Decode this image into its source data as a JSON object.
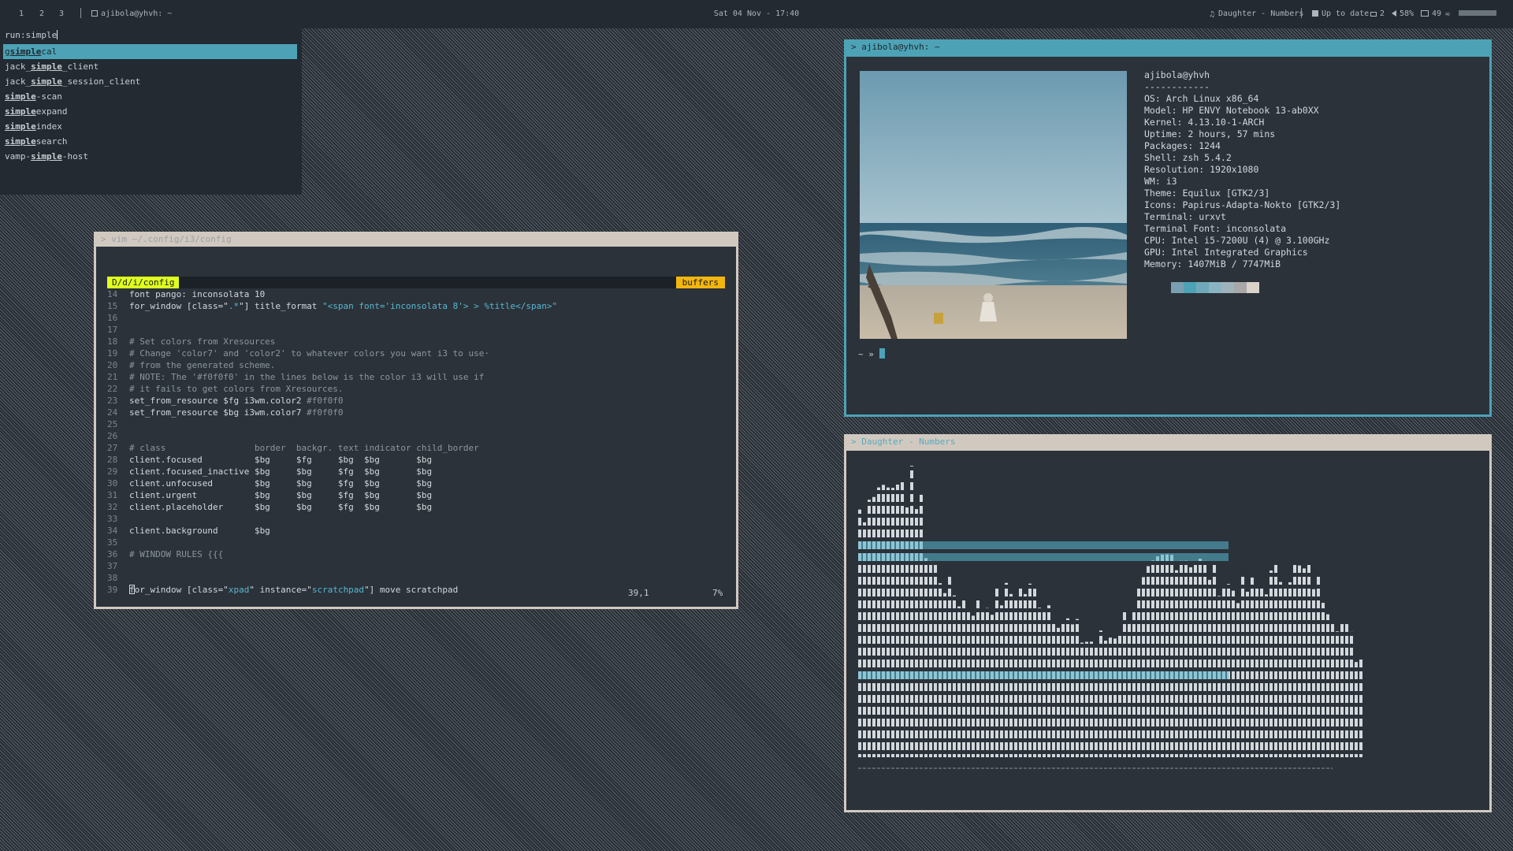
{
  "topbar": {
    "workspaces": [
      "1",
      "2",
      "3"
    ],
    "window_title": "ajibola@yhvh: ~",
    "clock": "Sat 04 Nov - 17:40",
    "music": "Daughter - Numbers",
    "updates": "Up to date",
    "mail_count": "2",
    "volume": "58%",
    "battery": "49"
  },
  "rofi": {
    "prompt": "run:simple",
    "items": [
      {
        "pre": "g",
        "match": "simple",
        "post": "cal",
        "selected": true
      },
      {
        "pre": "jack_",
        "match": "simple",
        "post": "_client",
        "selected": false
      },
      {
        "pre": "jack_",
        "match": "simple",
        "post": "_session_client",
        "selected": false
      },
      {
        "pre": "",
        "match": "simple",
        "post": "-scan",
        "selected": false
      },
      {
        "pre": "",
        "match": "simple",
        "post": "expand",
        "selected": false
      },
      {
        "pre": "",
        "match": "simple",
        "post": "index",
        "selected": false
      },
      {
        "pre": "",
        "match": "simple",
        "post": "search",
        "selected": false
      },
      {
        "pre": "vamp-",
        "match": "simple",
        "post": "-host",
        "selected": false
      }
    ]
  },
  "vim": {
    "title": "> vim ~/.config/i3/config",
    "file_tab": "D/d/i/config",
    "buffers_tab": "buffers",
    "ruler": "39,1",
    "percent": "7%",
    "lines": [
      {
        "n": "14",
        "segs": [
          [
            "t",
            "font pango: inconsolata 10"
          ]
        ]
      },
      {
        "n": "15",
        "segs": [
          [
            "t",
            "for_window [class=\""
          ],
          [
            "s",
            ".*"
          ],
          [
            "t",
            "\"] title_format "
          ],
          [
            "s",
            "\"<span font='inconsolata 8'> > %title</span>\""
          ]
        ]
      },
      {
        "n": "16",
        "segs": []
      },
      {
        "n": "17",
        "segs": []
      },
      {
        "n": "18",
        "segs": [
          [
            "c",
            "# Set colors from Xresources"
          ]
        ]
      },
      {
        "n": "19",
        "segs": [
          [
            "c",
            "# Change 'color7' and 'color2' to whatever colors you want i3 to use·"
          ]
        ]
      },
      {
        "n": "20",
        "segs": [
          [
            "c",
            "# from the generated scheme."
          ]
        ]
      },
      {
        "n": "21",
        "segs": [
          [
            "c",
            "# NOTE: The '#f0f0f0' in the lines below is the color i3 will use if"
          ]
        ]
      },
      {
        "n": "22",
        "segs": [
          [
            "c",
            "# it fails to get colors from Xresources."
          ]
        ]
      },
      {
        "n": "23",
        "segs": [
          [
            "t",
            "set_from_resource $fg i3wm.color2 "
          ],
          [
            "c",
            "#f0f0f0"
          ]
        ]
      },
      {
        "n": "24",
        "segs": [
          [
            "t",
            "set_from_resource $bg i3wm.color7 "
          ],
          [
            "c",
            "#f0f0f0"
          ]
        ]
      },
      {
        "n": "25",
        "segs": []
      },
      {
        "n": "26",
        "segs": []
      },
      {
        "n": "27",
        "segs": [
          [
            "c",
            "# class                 border  backgr. text indicator child_border"
          ]
        ]
      },
      {
        "n": "28",
        "segs": [
          [
            "t",
            "client.focused          $bg     $fg     $bg  $bg       $bg"
          ]
        ]
      },
      {
        "n": "29",
        "segs": [
          [
            "t",
            "client.focused_inactive $bg     $bg     $fg  $bg       $bg"
          ]
        ]
      },
      {
        "n": "30",
        "segs": [
          [
            "t",
            "client.unfocused        $bg     $bg     $fg  $bg       $bg"
          ]
        ]
      },
      {
        "n": "31",
        "segs": [
          [
            "t",
            "client.urgent           $bg     $bg     $fg  $bg       $bg"
          ]
        ]
      },
      {
        "n": "32",
        "segs": [
          [
            "t",
            "client.placeholder      $bg     $bg     $fg  $bg       $bg"
          ]
        ]
      },
      {
        "n": "33",
        "segs": []
      },
      {
        "n": "34",
        "segs": [
          [
            "t",
            "client.background       $bg"
          ]
        ]
      },
      {
        "n": "35",
        "segs": []
      },
      {
        "n": "36",
        "segs": [
          [
            "c",
            "# WINDOW RULES {{{"
          ]
        ]
      },
      {
        "n": "37",
        "segs": []
      },
      {
        "n": "38",
        "segs": []
      },
      {
        "n": "39",
        "segs": [
          [
            "k",
            "f"
          ],
          [
            "t",
            "or_window [class=\""
          ],
          [
            "s",
            "xpad"
          ],
          [
            "t",
            "\" instance=\""
          ],
          [
            "s",
            "scratchpad"
          ],
          [
            "t",
            "\"] move scratchpad"
          ]
        ]
      }
    ]
  },
  "terminal": {
    "title": "> ajibola@yhvh: ~",
    "user_host": "ajibola@yhvh",
    "underline": "------------",
    "info": [
      [
        "OS: ",
        "Arch Linux x86_64"
      ],
      [
        "Model: ",
        "HP ENVY Notebook 13-ab0XX"
      ],
      [
        "Kernel: ",
        "4.13.10-1-ARCH"
      ],
      [
        "Uptime: ",
        "2 hours, 57 mins"
      ],
      [
        "Packages: ",
        "1244"
      ],
      [
        "Shell: ",
        "zsh 5.4.2"
      ],
      [
        "Resolution: ",
        "1920x1080"
      ],
      [
        "WM: ",
        "i3"
      ],
      [
        "Theme: ",
        "Equilux [GTK2/3]"
      ],
      [
        "Icons: ",
        "Papirus-Adapta-Nokto [GTK2/3]"
      ],
      [
        "Terminal: ",
        "urxvt"
      ],
      [
        "Terminal Font: ",
        "inconsolata"
      ],
      [
        "CPU: ",
        "Intel i5-7200U (4) @ 3.100GHz"
      ],
      [
        "GPU: ",
        "Intel Integrated Graphics"
      ],
      [
        "Memory: ",
        "1407MiB / 7747MiB"
      ]
    ],
    "swatches": [
      "#2b323a",
      "#7a9fb2",
      "#4da2b6",
      "#6fa9b9",
      "#8ab4c2",
      "#9fb3bd",
      "#a8a8a8",
      "#dad3ca"
    ],
    "prompt": "~ »"
  },
  "cava": {
    "title": "> Daughter - Numbers",
    "colors": {
      "bar": "#d3d8dc",
      "accent": "#58b8d0",
      "baseline": "#8a939b"
    }
  }
}
